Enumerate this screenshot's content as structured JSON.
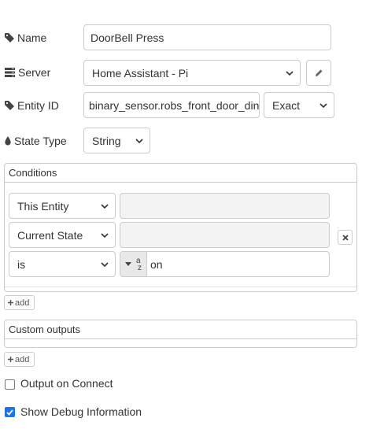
{
  "fields": {
    "name": {
      "label": "Name",
      "value": "DoorBell Press"
    },
    "server": {
      "label": "Server",
      "value": "Home Assistant - Pi"
    },
    "entity_id": {
      "label": "Entity ID",
      "value": "binary_sensor.robs_front_door_din",
      "match": "Exact"
    },
    "state_type": {
      "label": "State Type",
      "value": "String"
    }
  },
  "conditions": {
    "title": "Conditions",
    "rows": [
      {
        "select": "This Entity",
        "value": ""
      },
      {
        "select": "Current State",
        "value": ""
      },
      {
        "select": "is",
        "type_glyph": "a",
        "type_glyph_sub": "z",
        "value": "on"
      }
    ],
    "add_label": "add"
  },
  "custom_outputs": {
    "title": "Custom outputs",
    "add_label": "add"
  },
  "options": {
    "output_on_connect": {
      "label": "Output on Connect",
      "checked": false
    },
    "show_debug": {
      "label": "Show Debug Information",
      "checked": true
    }
  },
  "icons": {
    "name": "tag-icon",
    "server": "server-icon",
    "entity": "tag-icon",
    "state_type": "drop-icon",
    "edit": "pencil-icon",
    "remove": "close-icon",
    "add": "plus-icon"
  },
  "colors": {
    "check_accent": "#1a73e8",
    "border": "#cccccc"
  }
}
